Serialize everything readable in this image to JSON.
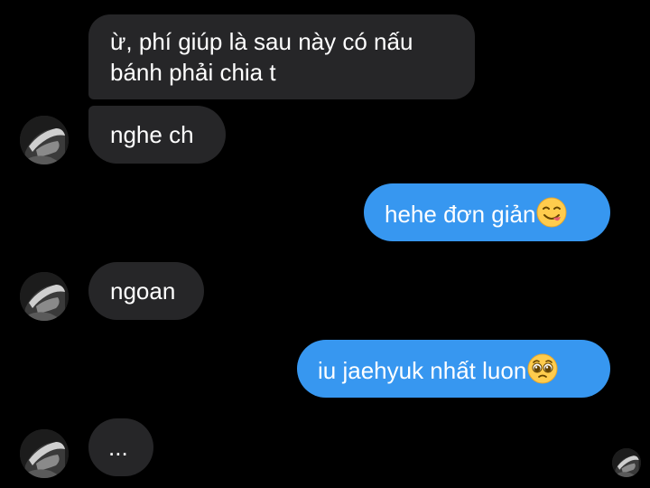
{
  "thread": {
    "messages": [
      {
        "side": "incoming",
        "text_line1": "ừ, phí giúp là sau này có nấu",
        "text_line2": "bánh phải chia t"
      },
      {
        "side": "incoming",
        "text": "nghe ch"
      },
      {
        "side": "outgoing",
        "text": "hehe đơn giản",
        "emoji": "yum-face-emoji"
      },
      {
        "side": "incoming",
        "text": "ngoan"
      },
      {
        "side": "outgoing",
        "text": "iu jaehyuk nhất luon",
        "emoji": "pleading-face-emoji"
      },
      {
        "side": "incoming",
        "text": "..."
      }
    ]
  },
  "colors": {
    "background": "#000000",
    "incoming_bubble": "#262628",
    "outgoing_bubble": "#3797f0",
    "text": "#ffffff"
  },
  "icons": [
    "contact-avatar",
    "seen-avatar",
    "yum-face-emoji",
    "pleading-face-emoji"
  ]
}
